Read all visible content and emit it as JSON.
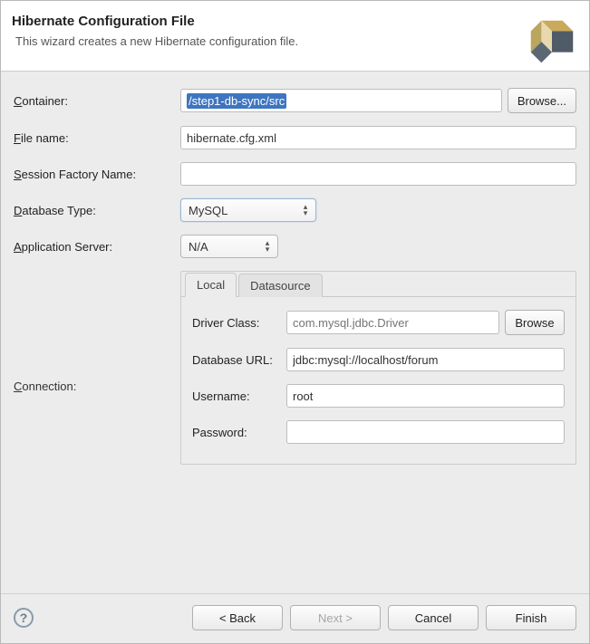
{
  "banner": {
    "title": "Hibernate Configuration File",
    "subtitle": "This wizard creates a new Hibernate configuration file."
  },
  "labels": {
    "container": "Container:",
    "fileName": "File name:",
    "sessionFactoryName": "Session Factory Name:",
    "databaseType": "Database Type:",
    "applicationServer": "Application Server:",
    "connection": "Connection:",
    "driverClass": "Driver Class:",
    "databaseUrl": "Database URL:",
    "username": "Username:",
    "password": "Password:"
  },
  "fields": {
    "container": "/step1-db-sync/src",
    "fileName": "hibernate.cfg.xml",
    "sessionFactoryName": "",
    "databaseType": "MySQL",
    "applicationServer": "N/A",
    "driverClassPlaceholder": "com.mysql.jdbc.Driver",
    "databaseUrl": "jdbc:mysql://localhost/forum",
    "username": "root",
    "password": ""
  },
  "tabs": {
    "local": "Local",
    "datasource": "Datasource"
  },
  "buttons": {
    "browseEllipsis": "Browse...",
    "browse": "Browse",
    "back": "< Back",
    "next": "Next >",
    "cancel": "Cancel",
    "finish": "Finish"
  }
}
